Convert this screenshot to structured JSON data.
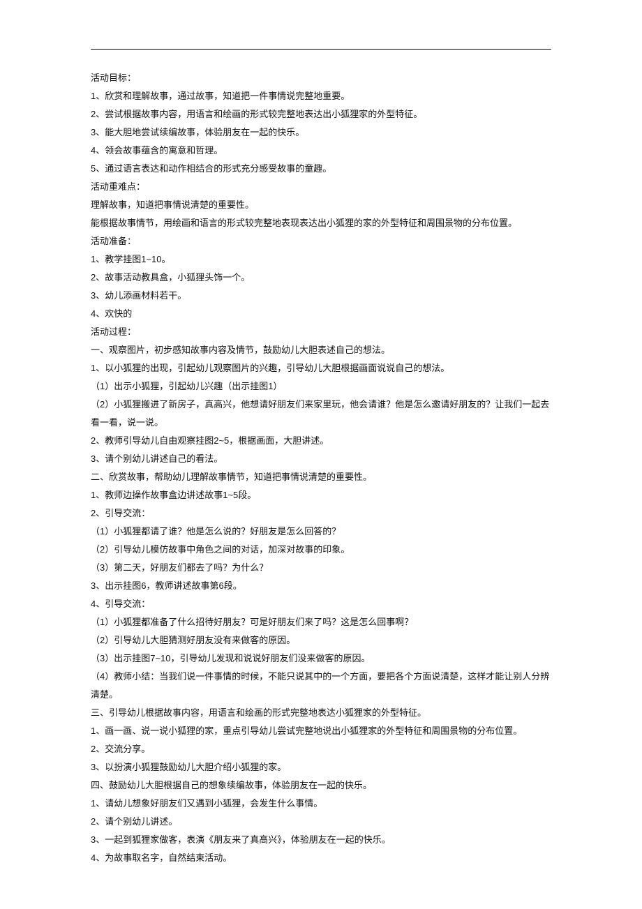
{
  "lines": [
    "活动目标：",
    "1、欣赏和理解故事，通过故事，知道把一件事情说完整地重要。",
    "2、尝试根据故事内容，用语言和绘画的形式较完整地表达出小狐狸家的外型特征。",
    "3、能大胆地尝试续编故事，体验朋友在一起的快乐。",
    "4、领会故事蕴含的寓意和哲理。",
    "5、通过语言表达和动作相结合的形式充分感受故事的童趣。",
    "活动重难点：",
    "理解故事，知道把事情说清楚的重要性。",
    "能根据故事情节，用绘画和语言的形式较完整地表现表达出小狐狸的家的外型特征和周围景物的分布位置。",
    "活动准备：",
    "1、教学挂图1~10。",
    "2、故事活动教具盒，小狐狸头饰一个。",
    "3、幼儿添画材料若干。",
    "4、欢快的",
    "活动过程：",
    "一、观察图片，初步感知故事内容及情节，鼓励幼儿大胆表述自己的想法。",
    "1、以小狐狸的出现，引起幼儿观察图片的兴趣，引导幼儿大胆根据画面说说自己的想法。",
    "（1）出示小狐狸，引起幼儿兴趣（出示挂图1）",
    "（2）小狐狸搬进了新房子，真高兴，他想请好朋友们来家里玩，他会请谁？他是怎么邀请好朋友的？让我们一起去看一看，说一说。",
    "2、教师引导幼儿自由观察挂图2~5，根据画面，大胆讲述。",
    "3、请个别幼儿讲述自己的看法。",
    "二、欣赏故事，帮助幼儿理解故事情节，知道把事情说清楚的重要性。",
    "1、教师边操作故事盒边讲述故事1~5段。",
    "2、引导交流：",
    "（1）小狐狸都请了谁？他是怎么说的？好朋友是怎么回答的？",
    "（2）引导幼儿模仿故事中角色之间的对话，加深对故事的印象。",
    "（3）第二天，好朋友们都去了吗？为什么？",
    "3、出示挂图6，教师讲述故事第6段。",
    "4、引导交流：",
    "（1）小狐狸都准备了什么招待好朋友？可是好朋友们来了吗？这是怎么回事啊？",
    "（2）引导幼儿大胆猜测好朋友没有来做客的原因。",
    "（3）出示挂图7~10，引导幼儿发现和说说好朋友们没来做客的原因。",
    "（4）教师小结：当我们说一件事情的时候，不能只说其中的一个方面，要把各个方面说清楚，这样才能让别人分辨清楚。",
    "三、引导幼儿根据故事内容，用语言和绘画的形式完整地表达小狐狸家的外型特征。",
    "1、画一画、说一说小狐狸的家，重点引导幼儿尝试完整地说出小狐狸家的外型特征和周围景物的分布位置。",
    "2、交流分享。",
    "3、以扮演小狐狸鼓励幼儿大胆介绍小狐狸的家。",
    "四、鼓励幼儿大胆根据自己的想象续编故事，体验朋友在一起的快乐。",
    "1、请幼儿想象好朋友们又遇到小狐狸，会发生什么事情。",
    "2、请个别幼儿讲述。",
    "3、一起到狐狸家做客，表演《朋友来了真高兴》，体验朋友在一起的快乐。",
    "4、为故事取名字，自然结束活动。"
  ]
}
